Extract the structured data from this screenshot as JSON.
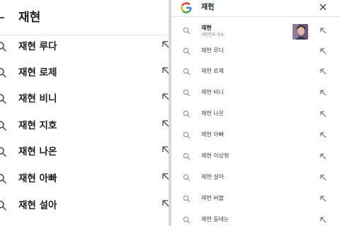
{
  "left": {
    "query": "재현",
    "suggestions": [
      "재현 루다",
      "재현 로제",
      "재현 비니",
      "재현 지호",
      "재현 나온",
      "재현 아빠",
      "재현 설아"
    ]
  },
  "right": {
    "query": "재현",
    "top_result": {
      "title": "재현",
      "subtitle": "대한민국 가수"
    },
    "suggestions": [
      "재현 루다",
      "재현 로제",
      "재현 비니",
      "재현 나온",
      "재현 아빠",
      "재현 이상형",
      "재현 설아",
      "재현 버블",
      "재현 동태눈"
    ]
  },
  "colors": {
    "text": "#202124",
    "icon": "#9aa0a6",
    "accent": "#1a73e8"
  },
  "icons": {
    "search": "search-icon",
    "arrow": "arrow-up-left-icon",
    "close": "close-icon",
    "logo": "google-logo-icon"
  }
}
